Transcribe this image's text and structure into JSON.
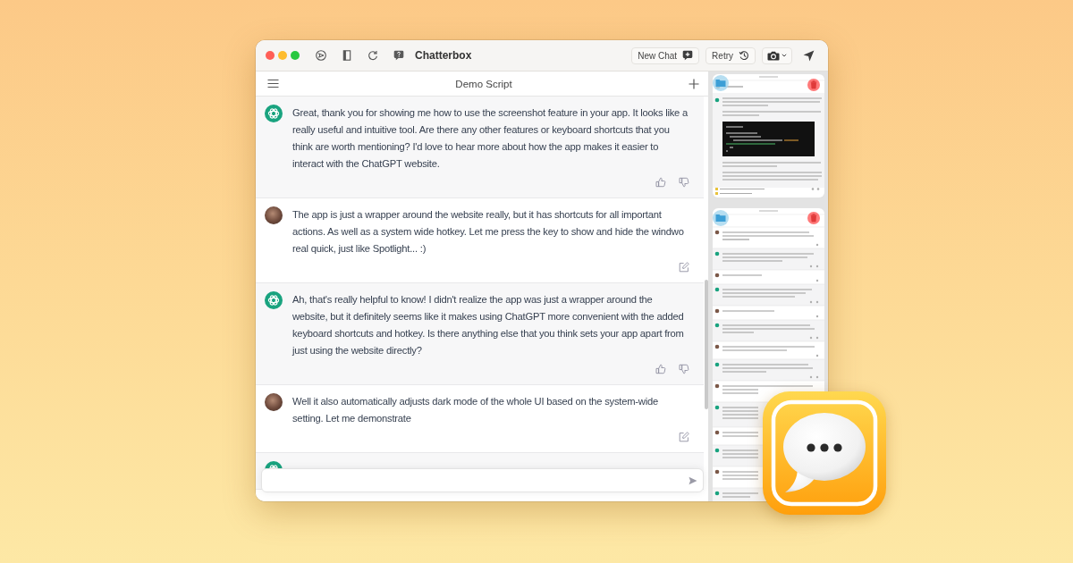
{
  "window": {
    "title": "Chatterbox"
  },
  "toolbar": {
    "buttons": [
      {
        "kind": "new_chat",
        "label": "New Chat"
      },
      {
        "kind": "retry",
        "label": "Retry"
      }
    ]
  },
  "chat": {
    "title": "Demo Script",
    "messages": [
      {
        "kind": "assistant",
        "text": "Great, thank you for showing me how to use the screenshot feature in your app. It looks like a really useful and intuitive tool. Are there any other features or keyboard shortcuts that you think are worth mentioning? I'd love to hear more about how the app makes it easier to interact with the ChatGPT website."
      },
      {
        "kind": "user",
        "text": "The app is just a wrapper around the website really, but it has shortcuts for all important actions. As well as a system wide hotkey. Let me press the key to show and hide the windwo real quick, just like Spotlight... :)"
      },
      {
        "kind": "assistant",
        "text": "Ah, that's really helpful to know! I didn't realize the app was just a wrapper around the website, but it definitely seems like it makes using ChatGPT more convenient with the added keyboard shortcuts and hotkey. Is there anything else that you think sets your app apart from just using the website directly?"
      },
      {
        "kind": "user",
        "text": "Well it also automatically adjusts dark mode of the whole UI based on the system-wide setting. Let me demonstrate"
      },
      {
        "kind": "assistant"
      }
    ]
  }
}
